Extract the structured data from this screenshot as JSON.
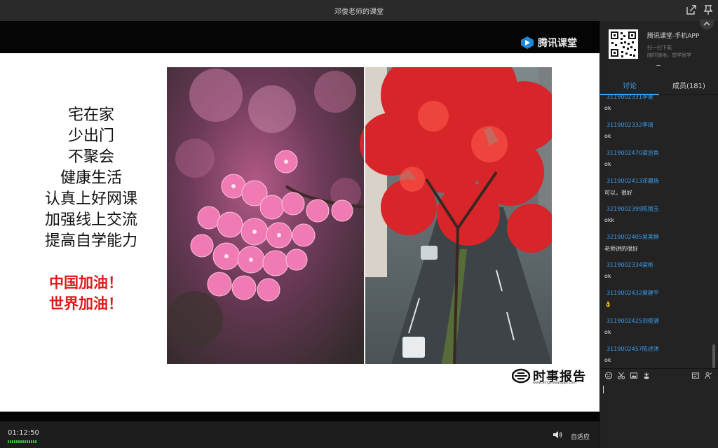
{
  "window": {
    "title": "邓俊老师的课堂"
  },
  "slide": {
    "brand": "腾讯课堂",
    "lines": [
      "宅在家",
      "少出门",
      "不聚会",
      "健康生活",
      "认真上好网课",
      "加强线上交流",
      "提高自学能力"
    ],
    "cheers": [
      "中国加油！",
      "世界加油！"
    ],
    "watermark": "时事报告",
    "watermark_url": "www.xingshibaogao.com"
  },
  "player": {
    "time": "01:12:50",
    "fit_label": "自适应"
  },
  "side": {
    "promo_title": "腾讯课堂-手机APP",
    "promo_sub1": "扫一扫下载",
    "promo_sub2": "随时随地，想学就学",
    "tabs": {
      "discuss": "讨论",
      "members": "成员(181)"
    },
    "messages": [
      {
        "user": "3119002331李聚",
        "text": "ok"
      },
      {
        "user": "3119002332李琦",
        "text": "ok"
      },
      {
        "user": "3119002470梁丞奂",
        "text": "ok"
      },
      {
        "user": "3119002413邓晨炀",
        "text": "可以，很好"
      },
      {
        "user": "3219002399陈丽玉",
        "text": "okk"
      },
      {
        "user": "3219002405吴美婷",
        "text": "老师讲的很好"
      },
      {
        "user": "3119002334梁彬",
        "text": "ok"
      },
      {
        "user": "3119002432莫建平",
        "text": "👌"
      },
      {
        "user": "3119002425刘俊源",
        "text": "ok"
      },
      {
        "user": "3119002457陈述沐",
        "text": "ok"
      }
    ]
  },
  "icons": {
    "share": "share-icon",
    "pin": "pin-icon",
    "volume": "volume-icon",
    "emoji": "emoji-icon",
    "scissors": "scissors-icon",
    "image": "image-icon",
    "flower": "flower-icon",
    "card": "card-icon",
    "hand": "raise-hand-icon"
  },
  "colors": {
    "accent": "#3aa0f3",
    "cheer": "#e01818",
    "signal": "#37c837"
  }
}
